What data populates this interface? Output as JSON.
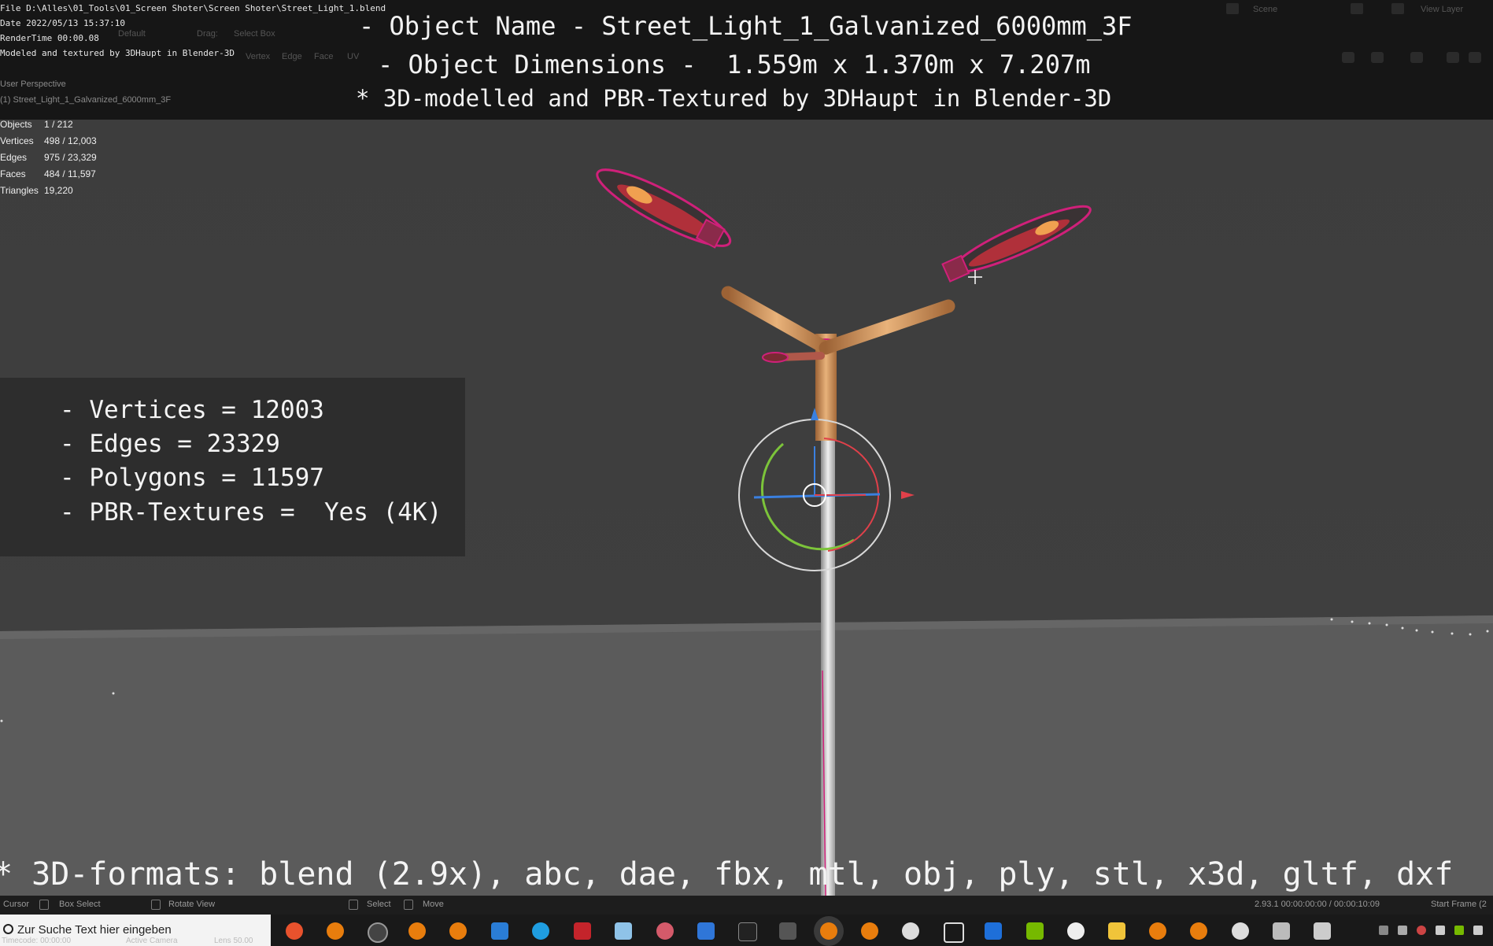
{
  "header": {
    "file_line": "File D:\\Alles\\01_Tools\\01_Screen Shoter\\Screen Shoter\\Street_Light_1.blend",
    "date_line": "Date 2022/05/13 15:37:10",
    "render_line": "RenderTime 00:00.08",
    "credit_line": "Modeled and textured by 3DHaupt in Blender-3D",
    "title_line1": "- Object Name - Street_Light_1_Galvanized_6000mm_3F",
    "title_line2": "- Object Dimensions -  1.559m x 1.370m x 7.207m",
    "title_line3": "* 3D-modelled and PBR-Textured by 3DHaupt in Blender-3D",
    "ghost_default": "Default",
    "ghost_drag": "Drag:",
    "ghost_select_box": "Select Box",
    "ghost_vertex": "Vertex",
    "ghost_edge": "Edge",
    "ghost_face": "Face",
    "ghost_uv": "UV",
    "ghost_scene": "Scene",
    "ghost_view_layer": "View Layer"
  },
  "viewport": {
    "perspective": "User Perspective",
    "object_label": "(1) Street_Light_1_Galvanized_6000mm_3F",
    "stats": [
      {
        "k": "Objects",
        "v": "1 / 212"
      },
      {
        "k": "Vertices",
        "v": "498 / 12,003"
      },
      {
        "k": "Edges",
        "v": "975 / 23,329"
      },
      {
        "k": "Faces",
        "v": "484 / 11,597"
      },
      {
        "k": "Triangles",
        "v": "19,220"
      }
    ],
    "info": {
      "vertices": "- Vertices = 12003",
      "edges": "- Edges = 23329",
      "polygons": "- Polygons = 11597",
      "textures": "- PBR-Textures =  Yes (4K)"
    },
    "formats": "* 3D-formats: blend (2.9x), abc, dae, fbx, mtl, obj, ply, stl, x3d, gltf, dxf"
  },
  "statusbar": {
    "cursor": "Cursor",
    "box_select": "Box Select",
    "rotate_view": "Rotate View",
    "select": "Select",
    "move": "Move",
    "version": "2.93.1   00:00:00:00 / 00:00:10:09",
    "start_frame": "Start Frame (2"
  },
  "taskbar": {
    "search_placeholder": "Zur Suche Text hier eingeben",
    "ghost_a": "Timecode: 00:00:00",
    "ghost_b": "Active Camera",
    "ghost_c": "Lens 50.00"
  },
  "colors": {
    "header_bg": "#161616",
    "viewport_bg": "#3d3d3d",
    "floor": "#5c5c5c",
    "selection_outline": "#d0207a",
    "pole_copper": "#c98c50",
    "pole_steel": "#cfcfcf",
    "gizmo_x": "#e0404a",
    "gizmo_y": "#7cc43a",
    "gizmo_z": "#3a80e0"
  },
  "icons": [
    "firefox-icon",
    "blender-icon",
    "steam-icon",
    "blender-icon",
    "blender-icon",
    "mail-icon",
    "edge-icon",
    "app-icon",
    "app-icon",
    "app-icon",
    "app-icon",
    "terminal-icon",
    "app-icon",
    "blender-icon",
    "blender-icon",
    "panda-icon",
    "cube-icon",
    "calendar-icon",
    "nvidia-icon",
    "app-icon",
    "folder-icon",
    "blender-icon",
    "blender-icon",
    "settings-icon",
    "app-icon",
    "app-icon"
  ]
}
